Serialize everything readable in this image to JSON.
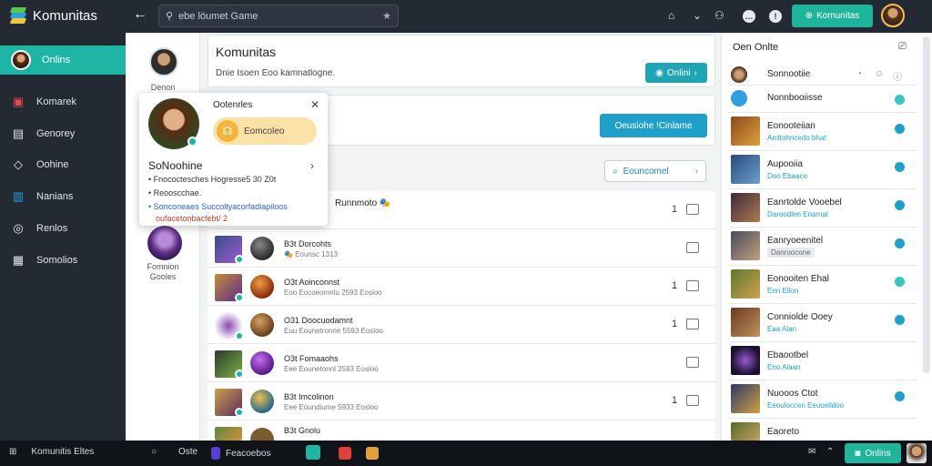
{
  "app": {
    "name": "Komunitas"
  },
  "topbar": {
    "back_icon": "arrow-left-icon",
    "search_placeholder": "ebe löumet Game",
    "cta_label": "Komunitas",
    "colors": {
      "bar": "#232a33",
      "accent": "#1fb59a"
    }
  },
  "sidebar": {
    "items": [
      {
        "label": "Onlins",
        "icon": "avatar"
      },
      {
        "label": "Komarek",
        "icon": "folder-icon"
      },
      {
        "label": "Genorey",
        "icon": "grid-icon"
      },
      {
        "label": "Oohine",
        "icon": "diamond-icon"
      },
      {
        "label": "Nanians",
        "icon": "chart-icon"
      },
      {
        "label": "Renlos",
        "icon": "circle-icon"
      },
      {
        "label": "Somolios",
        "icon": "table-icon"
      }
    ]
  },
  "left_column": {
    "users": [
      {
        "name": "Denon"
      },
      {
        "name": "Fomnion\nGooles"
      }
    ]
  },
  "main": {
    "header": {
      "title": "Komunitas",
      "subtitle": "Dnie Isoen Eoo kamnatlogne.",
      "button": "Onlini"
    },
    "post_box": {
      "button": "Oeusiohe !Cinlame"
    },
    "filter": {
      "label": "Eouncomel"
    },
    "rows": [
      {
        "title": "Runnmoto 🎭",
        "sub": "",
        "count": "1"
      },
      {
        "title": "B3t Dorcohts",
        "sub": "🎭 Eounsc 1313",
        "count": ""
      },
      {
        "title": "O3t Aoinconnst",
        "sub": "Eoo Eocoeomnlu 2593 Eosloo",
        "count": "1"
      },
      {
        "title": "O31 Doocuodamnt",
        "sub": "Euu Eounetronne 5593 Eosloo",
        "count": "1"
      },
      {
        "title": "O3t Fomaaohs",
        "sub": "Eee Eounetonnl 2593 Eosloo",
        "count": ""
      },
      {
        "title": "B3t Imcolinon",
        "sub": "Eee Eoundiume 5933 Eosloo",
        "count": "1"
      },
      {
        "title": "B3t Gnolu",
        "sub": "",
        "count": ""
      }
    ]
  },
  "popup": {
    "title": "Ootenrles",
    "pill": "Eomcoleo",
    "section": "SoNoohine",
    "lines": [
      "Fnococtesches Hogresse5 30 Z0t",
      "Reooscchae.",
      "Sonconeaes Succoltyacorfadiapiloos",
      "oufacetonbacfebt/ 2"
    ]
  },
  "right_panel": {
    "title": "Oen Onlte",
    "items": [
      {
        "name": "Sonnootiie",
        "sub": "",
        "status": "online"
      },
      {
        "name": "Nonnbooiisse",
        "sub": "",
        "status": "online"
      },
      {
        "name": "Eonooteiian",
        "sub": "Amltohncedo bhat",
        "status": "online"
      },
      {
        "name": "Aupooiia",
        "sub": "Doo Ebaaco",
        "status": "online"
      },
      {
        "name": "Eanrtolde Vooebel",
        "sub": "Daroodlen Enarnal",
        "status": "online"
      },
      {
        "name": "Eanryoeenitel",
        "sub": "Danroocone",
        "status": "online"
      },
      {
        "name": "Eonooiten Ehal",
        "sub": "Enn Eilon",
        "status": "online"
      },
      {
        "name": "Conniolde Ooey",
        "sub": "Eaa Alan",
        "status": "online"
      },
      {
        "name": "Ebaootbel",
        "sub": "Eno Alaan",
        "status": "online"
      },
      {
        "name": "Nuooos Ctot",
        "sub": "Eeouloccen Eeuoelldoo",
        "status": "online"
      },
      {
        "name": "Eaoreto",
        "sub": "",
        "status": "online"
      }
    ]
  },
  "taskbar": {
    "app_label": "Komunitis Eltes",
    "tab1": "Oste",
    "tab2": "Feacoebos",
    "online": "Onlins"
  }
}
